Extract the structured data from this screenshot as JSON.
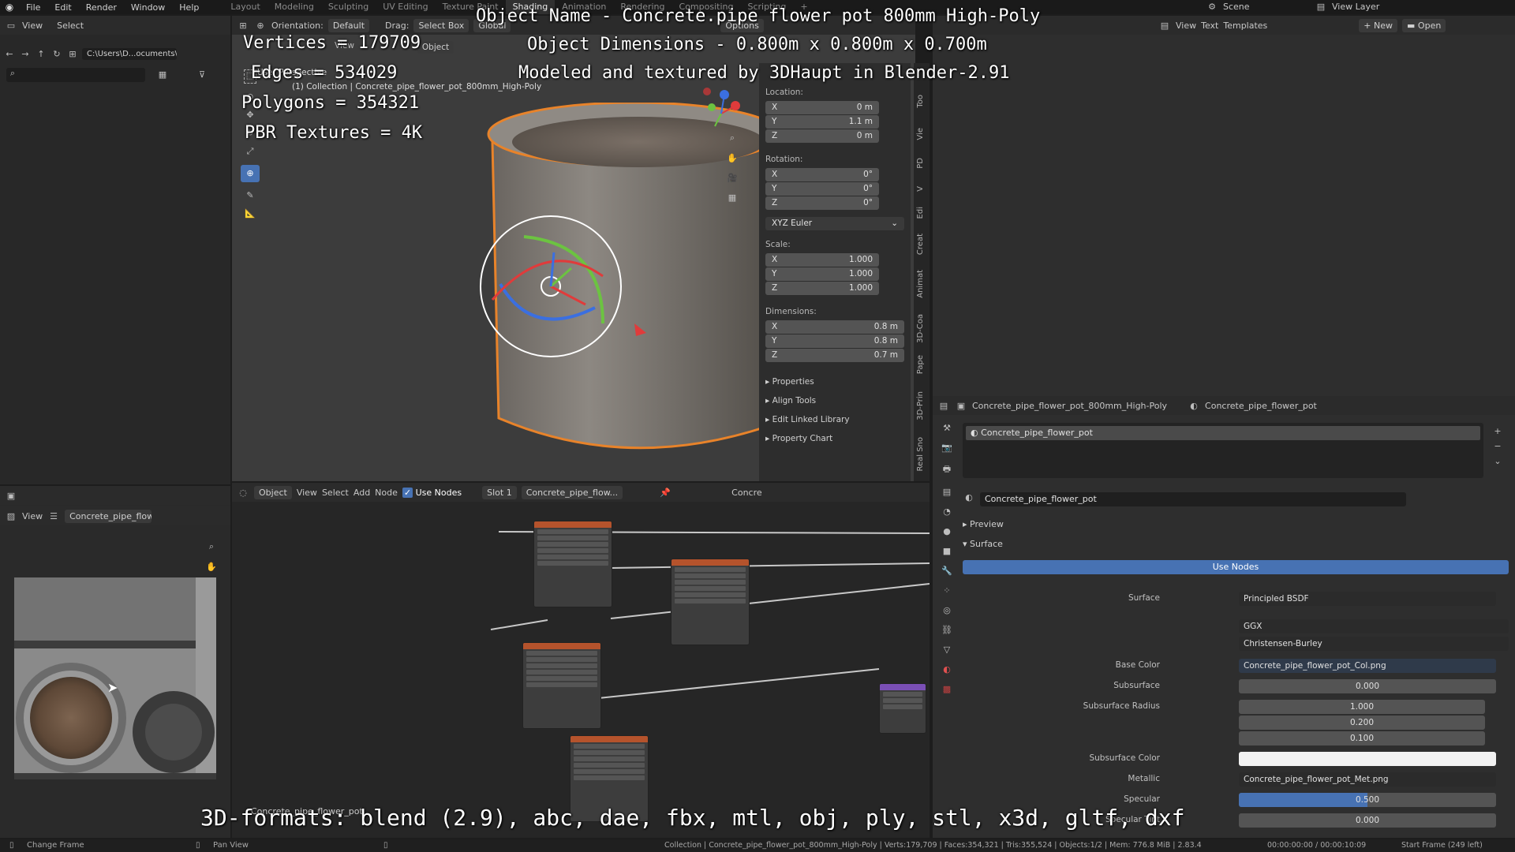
{
  "menu": [
    "File",
    "Edit",
    "Render",
    "Window",
    "Help"
  ],
  "workspaces": [
    "Layout",
    "Modeling",
    "Sculpting",
    "UV Editing",
    "Texture Paint",
    "Shading",
    "Animation",
    "Rendering",
    "Compositing",
    "Scripting"
  ],
  "active_workspace": "Shading",
  "scene_label": "Scene",
  "view_layer_label": "View Layer",
  "file_browser": {
    "view": "View",
    "select": "Select",
    "path": "C:\\Users\\D...ocuments\\"
  },
  "viewport": {
    "orientation_label": "Orientation:",
    "orientation_value": "Default",
    "drag_label": "Drag:",
    "drag_value": "Select Box",
    "transform_value": "Global",
    "options": "Options",
    "view": "View",
    "object": "Object",
    "perspective": "User Perspective",
    "collection": "(1) Collection | Concrete_pipe_flower_pot_800mm_High-Poly"
  },
  "overlay": {
    "object_name": "Object Name - Concrete.pipe flower pot 800mm High-Poly",
    "dimensions": "Object Dimensions - 0.800m x 0.800m x 0.700m",
    "modeled": "Modeled and textured by 3DHaupt in Blender-2.91",
    "vertices": "Vertices = 179709",
    "edges": "Edges = 534029",
    "polygons": "Polygons = 354321",
    "textures": "PBR Textures = 4K",
    "formats": "3D-formats: blend (2.9), abc, dae, fbx, mtl, obj, ply, stl, x3d, gltf, dxf"
  },
  "n_panel": {
    "location_label": "Location:",
    "location": [
      {
        "axis": "X",
        "value": "0 m"
      },
      {
        "axis": "Y",
        "value": "1.1 m"
      },
      {
        "axis": "Z",
        "value": "0 m"
      }
    ],
    "rotation_label": "Rotation:",
    "rotation": [
      {
        "axis": "X",
        "value": "0°"
      },
      {
        "axis": "Y",
        "value": "0°"
      },
      {
        "axis": "Z",
        "value": "0°"
      }
    ],
    "rotation_mode": "XYZ Euler",
    "scale_label": "Scale:",
    "scale": [
      {
        "axis": "X",
        "value": "1.000"
      },
      {
        "axis": "Y",
        "value": "1.000"
      },
      {
        "axis": "Z",
        "value": "1.000"
      }
    ],
    "dimensions_label": "Dimensions:",
    "dimensions": [
      {
        "axis": "X",
        "value": "0.8 m"
      },
      {
        "axis": "Y",
        "value": "0.8 m"
      },
      {
        "axis": "Z",
        "value": "0.7 m"
      }
    ],
    "sections": [
      "Properties",
      "Align Tools",
      "Edit Linked Library",
      "Property Chart"
    ],
    "tabs": [
      "Too",
      "Vie",
      "PD",
      "V",
      "Edi",
      "Creat",
      "Animat",
      "3D-Coa",
      "Pape",
      "3D-Prin",
      "Real Sno"
    ]
  },
  "text_editor": {
    "view": "View",
    "text": "Text",
    "templates": "Templates",
    "new": "New",
    "open": "Open"
  },
  "image_editor": {
    "view": "View",
    "image_name": "Concrete_pipe_flow..."
  },
  "node_editor": {
    "object": "Object",
    "view": "View",
    "select": "Select",
    "add": "Add",
    "node": "Node",
    "use_nodes": "Use Nodes",
    "slot": "Slot 1",
    "material": "Concrete_pipe_flow...",
    "material2": "Concre",
    "footer": "Concrete_pipe_flower_pot"
  },
  "properties": {
    "object_name": "Concrete_pipe_flower_pot_800mm_High-Poly",
    "material_name": "Concrete_pipe_flower_pot",
    "slot_item": "Concrete_pipe_flower_pot",
    "material_field": "Concrete_pipe_flower_pot",
    "preview": "Preview",
    "surface_section": "Surface",
    "use_nodes": "Use Nodes",
    "rows": [
      {
        "label": "Surface",
        "value": "Principled BSDF"
      },
      {
        "label": "",
        "value": "GGX"
      },
      {
        "label": "",
        "value": "Christensen-Burley"
      },
      {
        "label": "Base Color",
        "value": "Concrete_pipe_flower_pot_Col.png"
      },
      {
        "label": "Subsurface",
        "value": "0.000"
      },
      {
        "label": "Subsurface Radius",
        "value": "1.000"
      },
      {
        "label": "",
        "value": "0.200"
      },
      {
        "label": "",
        "value": "0.100"
      },
      {
        "label": "Subsurface Color",
        "value": ""
      },
      {
        "label": "Metallic",
        "value": "Concrete_pipe_flower_pot_Met.png"
      },
      {
        "label": "Specular",
        "value": "0.500"
      },
      {
        "label": "Specular Tint",
        "value": "0.000"
      }
    ]
  },
  "status": {
    "change_frame": "Change Frame",
    "pan_view": "Pan View",
    "info": "Collection | Concrete_pipe_flower_pot_800mm_High-Poly | Verts:179,709 | Faces:354,321 | Tris:355,524 | Objects:1/2 | Mem: 776.8 MiB | 2.83.4",
    "time": "00:00:00:00 / 00:00:10:09",
    "start_frame": "Start Frame (249 left)"
  },
  "colors": {
    "accent_blue": "#4772b3",
    "selection_orange": "#e8832a"
  }
}
